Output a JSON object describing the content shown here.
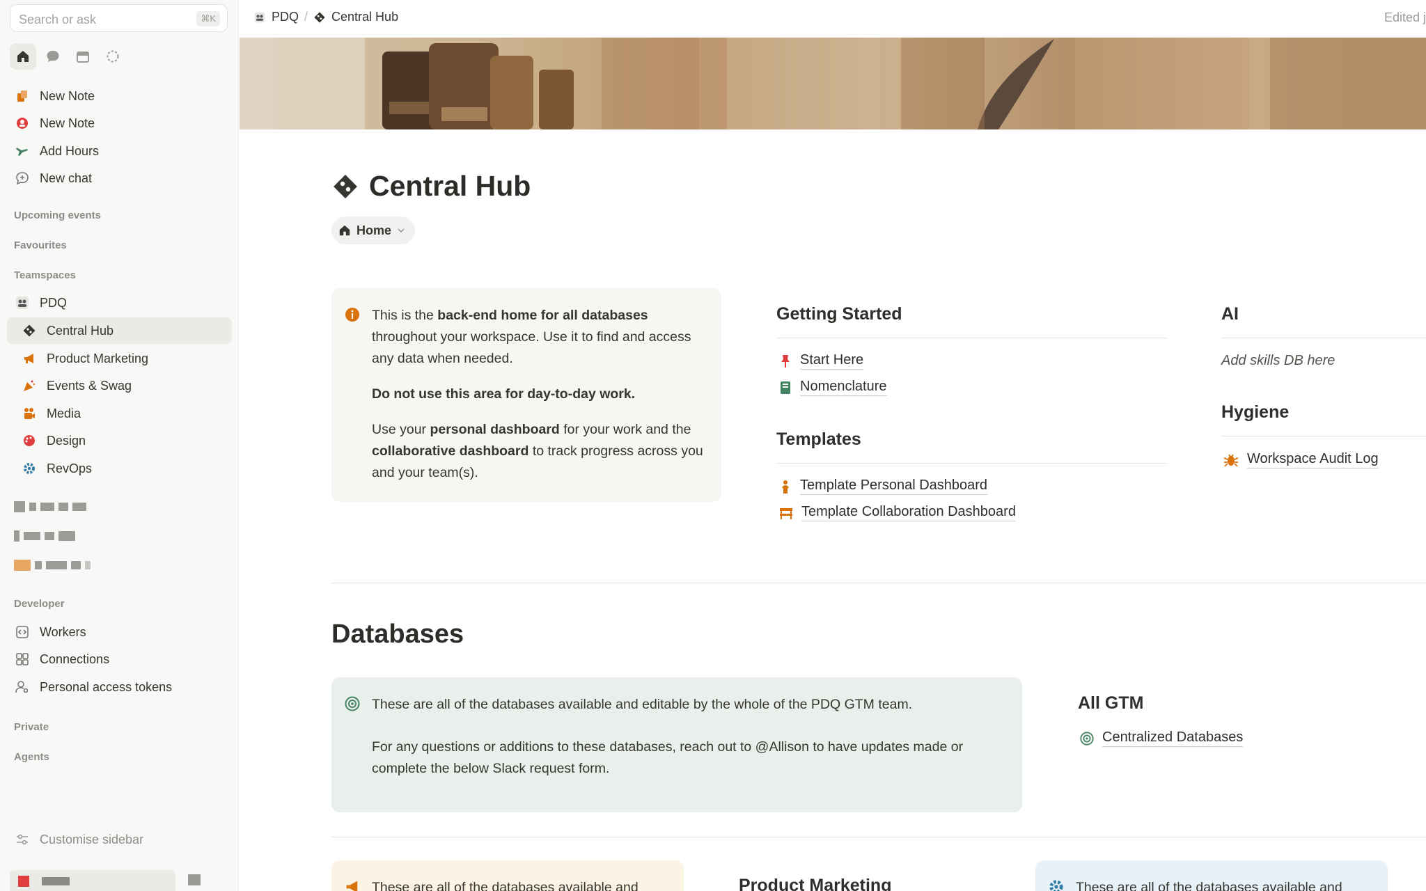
{
  "sidebar": {
    "search_placeholder": "Search or ask",
    "search_shortcut": "⌘K",
    "top_icons": [
      "home-icon",
      "chat-icon",
      "calendar-icon",
      "loader-icon"
    ],
    "quick_actions": [
      {
        "label": "New Note",
        "icon": "new-note-icon",
        "color": "#d9730d"
      },
      {
        "label": "New Note",
        "icon": "new-note-alt-icon",
        "color": "#e03e3e"
      },
      {
        "label": "Add Hours",
        "icon": "plane-icon",
        "color": "#448361"
      },
      {
        "label": "New chat",
        "icon": "chat-plus-icon",
        "color": "#787774"
      }
    ],
    "sections": {
      "upcoming": "Upcoming events",
      "favourites": "Favourites",
      "teamspaces": "Teamspaces",
      "developer": "Developer",
      "private": "Private",
      "agents": "Agents"
    },
    "teamspace": {
      "label": "PDQ",
      "icon": "teamspace-icon"
    },
    "team_pages": [
      {
        "label": "Central Hub",
        "icon": "git-icon",
        "color": "#37352f"
      },
      {
        "label": "Product Marketing",
        "icon": "megaphone-icon",
        "color": "#d9730d"
      },
      {
        "label": "Events & Swag",
        "icon": "party-icon",
        "color": "#d9730d"
      },
      {
        "label": "Media",
        "icon": "video-icon",
        "color": "#d9730d"
      },
      {
        "label": "Design",
        "icon": "palette-icon",
        "color": "#e03e3e"
      },
      {
        "label": "RevOps",
        "icon": "gear-icon",
        "color": "#337ea9"
      }
    ],
    "developer_items": [
      {
        "label": "Workers",
        "icon": "code-icon"
      },
      {
        "label": "Connections",
        "icon": "grid-icon"
      },
      {
        "label": "Personal access tokens",
        "icon": "person-key-icon"
      }
    ],
    "customise": "Customise sidebar"
  },
  "topbar": {
    "breadcrumb": [
      "PDQ",
      "Central Hub"
    ],
    "edited": "Edited j"
  },
  "page": {
    "title": "Central Hub",
    "view_pill": "Home",
    "info_callout": {
      "line1_pre": "This is the ",
      "line1_bold": "back-end home for all databases",
      "line1_post": " throughout your workspace. Use it to find and access any data when needed.",
      "warning": "Do not use this area for day-to-day work.",
      "line3_a": "Use your ",
      "line3_b": "personal dashboard",
      "line3_c": " for your work and the ",
      "line3_d": "collaborative dashboard",
      "line3_e": " to track progress across you and your team(s)."
    },
    "getting_started": {
      "heading": "Getting Started",
      "links": [
        {
          "label": "Start Here",
          "icon": "pin-icon"
        },
        {
          "label": "Nomenclature",
          "icon": "book-icon"
        }
      ]
    },
    "templates": {
      "heading": "Templates",
      "links": [
        {
          "label": "Template Personal Dashboard",
          "icon": "person-icon"
        },
        {
          "label": "Template Collaboration Dashboard",
          "icon": "group-icon"
        }
      ]
    },
    "ai": {
      "heading": "AI",
      "placeholder": "Add skills DB here"
    },
    "hygiene": {
      "heading": "Hygiene",
      "links": [
        {
          "label": "Workspace Audit Log",
          "icon": "bug-icon"
        }
      ]
    },
    "databases_heading": "Databases",
    "db_callout": {
      "p1": "These are all of the databases available and editable by the whole of the PDQ GTM team.",
      "p2": "For any questions or additions to these databases, reach out to @Allison to have updates made or complete the below Slack request form."
    },
    "all_gtm": {
      "heading": "All GTM",
      "links": [
        {
          "label": "Centralized Databases",
          "icon": "target-icon"
        }
      ]
    },
    "bottom": {
      "left_callout": "These are all of the databases available and",
      "mid_heading": "Product Marketing",
      "right_callout": "These are all of the databases available and"
    }
  },
  "colors": {
    "accent_orange": "#d9730d",
    "callout_gray": "#f7f6f3",
    "callout_green": "#e9f0ec",
    "callout_yellow": "#fbf3e4",
    "callout_blue": "#e7f1f8"
  }
}
